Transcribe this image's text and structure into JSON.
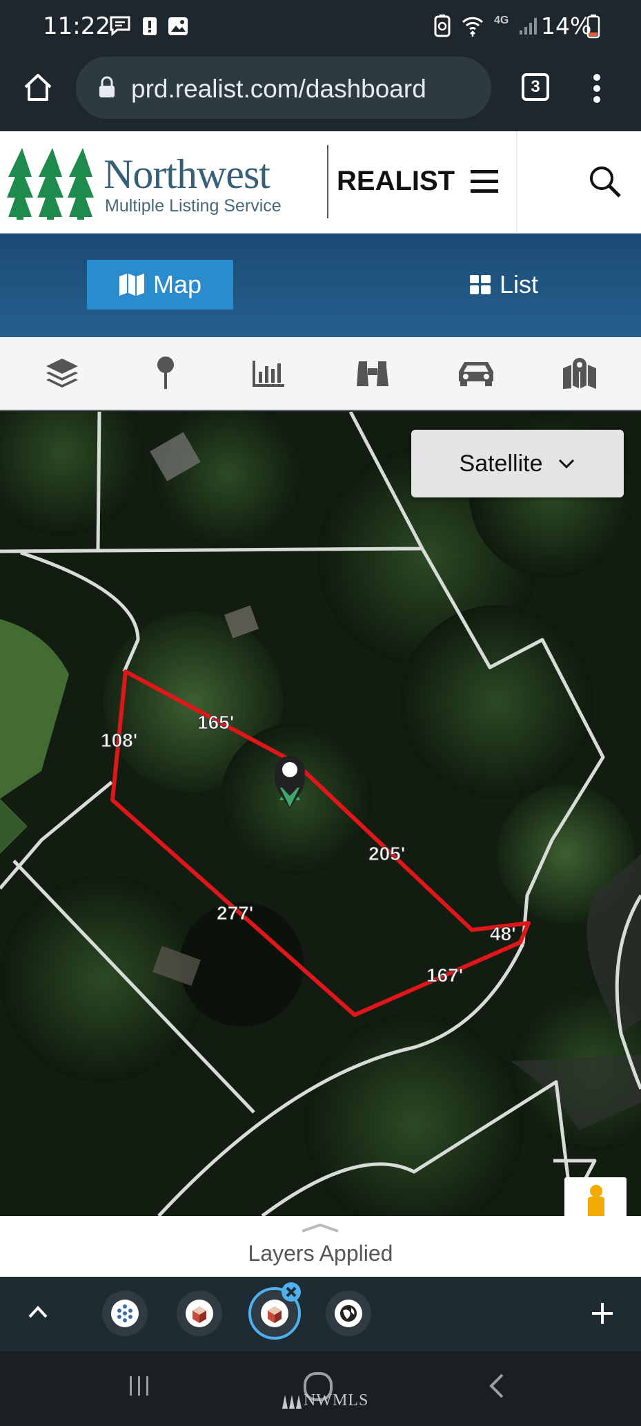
{
  "status_bar": {
    "time": "11:22",
    "battery": "14%",
    "network": "4G",
    "left_icons": [
      "chat-icon",
      "alert-icon",
      "image-icon"
    ],
    "right_icons": [
      "battery-saver-icon",
      "wifi-calling-icon",
      "signal-icon"
    ]
  },
  "browser": {
    "url": "prd.realist.com/dashboard",
    "tab_count": "3"
  },
  "header": {
    "brand_name": "Northwest",
    "brand_sub": "Multiple Listing Service",
    "product": "REALIST"
  },
  "view_toggle": {
    "map_label": "Map",
    "list_label": "List",
    "active": "Map"
  },
  "toolbar": {
    "tools": [
      "layers-icon",
      "pin-icon",
      "chart-icon",
      "binoculars-icon",
      "car-icon",
      "map-marker-icon"
    ]
  },
  "map": {
    "basemap": "Satellite",
    "parcel_dimensions": [
      "108'",
      "165'",
      "205'",
      "48'",
      "167'",
      "277'"
    ]
  },
  "layers": {
    "label": "Layers Applied"
  },
  "bottom": {
    "layer_icons": [
      "pattern-layer-icon",
      "parcel-layer-icon",
      "parcel-layer-active-icon",
      "globe-layer-icon"
    ]
  },
  "nav": {
    "watermark": "NWMLS"
  },
  "colors": {
    "brand_green": "#1e8a4c",
    "brand_blue": "#365f78",
    "viewbar_blue": "#1c4b74",
    "map_button": "#2a8ccd",
    "parcel_outline": "#e0161a",
    "lot_lines": "#d8dcd8"
  }
}
